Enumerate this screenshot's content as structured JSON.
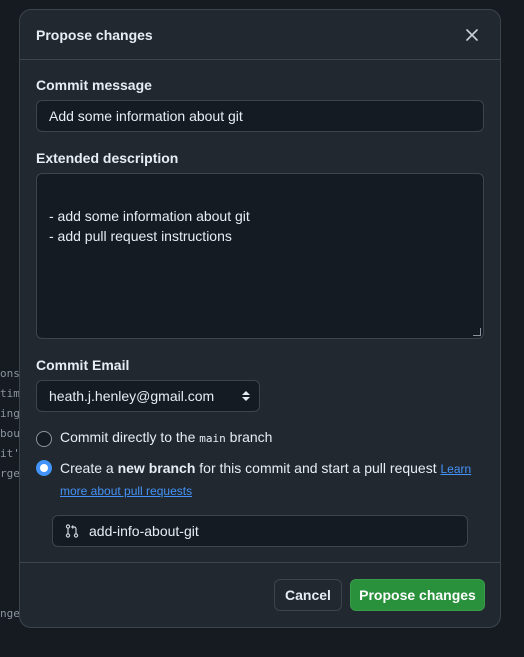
{
  "background_code": [
    "ons",
    "time",
    "ing",
    "bout",
    "it'",
    "rge",
    "nges"
  ],
  "dialog": {
    "title": "Propose changes",
    "close_icon": "close-icon"
  },
  "commit_message": {
    "label": "Commit message",
    "value": "Add some information about git"
  },
  "extended_description": {
    "label": "Extended description",
    "value": "- add some information about git\n- add pull request instructions"
  },
  "commit_email": {
    "label": "Commit Email",
    "selected": "heath.j.henley@gmail.com"
  },
  "options": {
    "direct": {
      "prefix": "Commit directly to the ",
      "branch": "main",
      "suffix": " branch",
      "checked": false
    },
    "new_branch": {
      "prefix": "Create a ",
      "bold": "new branch",
      "suffix": " for this commit and start a pull request ",
      "link": "Learn more about pull requests",
      "checked": true
    }
  },
  "branch_name": {
    "value": "add-info-about-git",
    "icon": "git-pull-request-icon"
  },
  "footer": {
    "cancel_label": "Cancel",
    "propose_label": "Propose changes"
  },
  "colors": {
    "accent": "#4493f8",
    "primary_button": "#29903b",
    "surface": "#212830",
    "input_bg": "#151b23",
    "border": "#3d444d"
  }
}
